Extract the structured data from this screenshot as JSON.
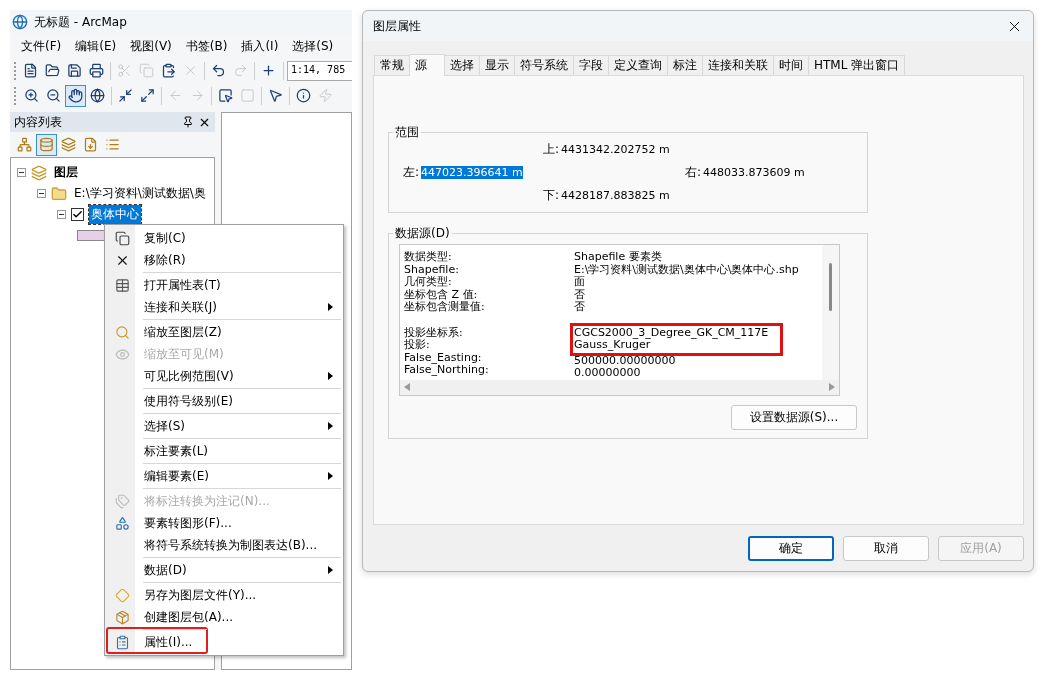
{
  "app_window": {
    "title": "无标题 - ArcMap",
    "menu": [
      "文件(F)",
      "编辑(E)",
      "视图(V)",
      "书签(B)",
      "插入(I)",
      "选择(S)"
    ],
    "toolbar_1": [
      {
        "disabled": false
      },
      {
        "disabled": false
      },
      {
        "disabled": false
      },
      {
        "disabled": false
      },
      {
        "disabled": true
      },
      {
        "disabled": true
      },
      {
        "disabled": false
      },
      {
        "disabled": true
      },
      {
        "disabled": false
      },
      {
        "disabled": true
      },
      {
        "disabled": false
      }
    ],
    "scale": "1:14, 785",
    "toolbar_2": [
      {
        "selected": false,
        "disabled": false
      },
      {
        "selected": false,
        "disabled": false
      },
      {
        "selected": true,
        "disabled": false
      },
      {
        "selected": false,
        "disabled": false
      },
      {
        "selected": false,
        "disabled": false
      },
      {
        "selected": false,
        "disabled": false
      },
      {
        "selected": false,
        "disabled": true
      },
      {
        "selected": false,
        "disabled": true
      },
      {
        "selected": false,
        "disabled": false
      },
      {
        "selected": false,
        "disabled": true
      },
      {
        "selected": false,
        "disabled": false
      },
      {
        "selected": false,
        "disabled": false
      },
      {
        "selected": false,
        "disabled": true
      }
    ],
    "toc": {
      "title": "内容列表",
      "tools": [
        {
          "selected": false
        },
        {
          "selected": true
        },
        {
          "selected": false
        },
        {
          "selected": false
        },
        {
          "selected": false
        }
      ],
      "tree": [
        {
          "label": "图层",
          "expanded": true,
          "children": [
            {
              "label": "E:\\学习资料\\测试数据\\奥",
              "expanded": true,
              "children": [
                {
                  "label": "奥体中心",
                  "expanded": true,
                  "checked": true,
                  "selected": true
                }
              ]
            }
          ]
        }
      ]
    }
  },
  "context_menu": [
    {
      "label": "复制(C)",
      "disabled": false,
      "submenu": false,
      "separator_before": false,
      "highlighted": false
    },
    {
      "label": "移除(R)",
      "disabled": false,
      "submenu": false,
      "separator_before": false,
      "highlighted": false
    },
    {
      "label": "打开属性表(T)",
      "disabled": false,
      "submenu": false,
      "separator_before": true,
      "highlighted": false
    },
    {
      "label": "连接和关联(J)",
      "disabled": false,
      "submenu": true,
      "separator_before": false,
      "highlighted": false
    },
    {
      "label": "缩放至图层(Z)",
      "disabled": false,
      "submenu": false,
      "separator_before": true,
      "highlighted": false
    },
    {
      "label": "缩放至可见(M)",
      "disabled": true,
      "submenu": false,
      "separator_before": false,
      "highlighted": false
    },
    {
      "label": "可见比例范围(V)",
      "disabled": false,
      "submenu": true,
      "separator_before": false,
      "highlighted": false
    },
    {
      "label": "使用符号级别(E)",
      "disabled": false,
      "submenu": false,
      "separator_before": true,
      "highlighted": false
    },
    {
      "label": "选择(S)",
      "disabled": false,
      "submenu": true,
      "separator_before": true,
      "highlighted": false
    },
    {
      "label": "标注要素(L)",
      "disabled": false,
      "submenu": false,
      "separator_before": true,
      "highlighted": false
    },
    {
      "label": "编辑要素(E)",
      "disabled": false,
      "submenu": true,
      "separator_before": true,
      "highlighted": false
    },
    {
      "label": "将标注转换为注记(N)...",
      "disabled": true,
      "submenu": false,
      "separator_before": true,
      "highlighted": false
    },
    {
      "label": "要素转图形(F)...",
      "disabled": false,
      "submenu": false,
      "separator_before": false,
      "highlighted": false
    },
    {
      "label": "将符号系统转换为制图表达(B)...",
      "disabled": false,
      "submenu": false,
      "separator_before": false,
      "highlighted": false
    },
    {
      "label": "数据(D)",
      "disabled": false,
      "submenu": true,
      "separator_before": true,
      "highlighted": false
    },
    {
      "label": "另存为图层文件(Y)...",
      "disabled": false,
      "submenu": false,
      "separator_before": true,
      "highlighted": false
    },
    {
      "label": "创建图层包(A)...",
      "disabled": false,
      "submenu": false,
      "separator_before": false,
      "highlighted": false
    },
    {
      "label": "属性(I)...",
      "disabled": false,
      "submenu": false,
      "separator_before": true,
      "highlighted": true
    }
  ],
  "dialog": {
    "title": "图层属性",
    "tabs": [
      {
        "label": "常规",
        "selected": false
      },
      {
        "label": "源",
        "selected": true
      },
      {
        "label": "选择",
        "selected": false
      },
      {
        "label": "显示",
        "selected": false
      },
      {
        "label": "符号系统",
        "selected": false
      },
      {
        "label": "字段",
        "selected": false
      },
      {
        "label": "定义查询",
        "selected": false
      },
      {
        "label": "标注",
        "selected": false
      },
      {
        "label": "连接和关联",
        "selected": false
      },
      {
        "label": "时间",
        "selected": false
      },
      {
        "label": "HTML 弹出窗口",
        "selected": false
      }
    ],
    "extent": {
      "title": "范围",
      "items": [
        {
          "label": "上:",
          "value": "4431342.202752 m",
          "selected": false
        },
        {
          "label": "左:",
          "value": "447023.396641 m",
          "selected": true
        },
        {
          "label": "右:",
          "value": "448033.873609 m",
          "selected": false
        },
        {
          "label": "下:",
          "value": "4428187.883825 m",
          "selected": false
        }
      ]
    },
    "data_source": {
      "title": "数据源(D)",
      "rows": [
        {
          "label": "数据类型:",
          "value": "Shapefile 要素类",
          "gap_before": false,
          "highlighted": false
        },
        {
          "label": "Shapefile:",
          "value": "E:\\学习资料\\测试数据\\奥体中心\\奥体中心.shp",
          "gap_before": false,
          "highlighted": false
        },
        {
          "label": "几何类型:",
          "value": "面",
          "gap_before": false,
          "highlighted": false
        },
        {
          "label": "坐标包含 Z 值:",
          "value": "否",
          "gap_before": false,
          "highlighted": false
        },
        {
          "label": "坐标包含测量值:",
          "value": "否",
          "gap_before": false,
          "highlighted": false
        },
        {
          "label": "投影坐标系:",
          "value": "CGCS2000_3_Degree_GK_CM_117E",
          "gap_before": true,
          "highlighted": true
        },
        {
          "label": "投影:",
          "value": "Gauss_Kruger",
          "gap_before": false,
          "highlighted": true
        },
        {
          "label": "False_Easting:",
          "value": "500000.00000000",
          "gap_before": false,
          "highlighted": false
        },
        {
          "label": "False_Northing:",
          "value": "0.00000000",
          "gap_before": false,
          "highlighted": false
        }
      ],
      "button": "设置数据源(S)..."
    },
    "buttons": [
      {
        "label": "确定",
        "default": true,
        "disabled": false
      },
      {
        "label": "取消",
        "default": false,
        "disabled": false
      },
      {
        "label": "应用(A)",
        "default": false,
        "disabled": true
      }
    ]
  }
}
